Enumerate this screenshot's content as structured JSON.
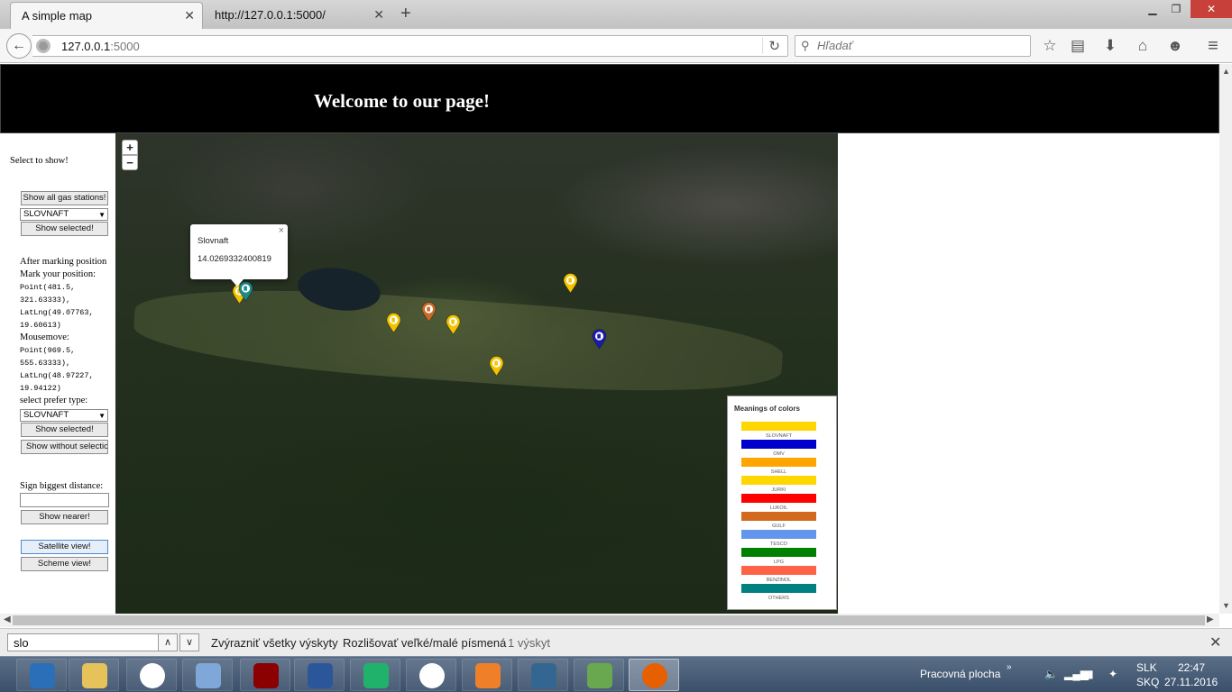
{
  "browser": {
    "tabs": [
      {
        "title": "A simple map",
        "active": true
      },
      {
        "title": "http://127.0.0.1:5000/",
        "active": false
      }
    ],
    "url": "127.0.0.1:5000",
    "url_host": "127.0.0.1",
    "url_port": ":5000",
    "search_placeholder": "Hľadať",
    "icons": [
      "back-arrow-icon",
      "reload-icon",
      "search-icon",
      "bookmark-star-icon",
      "reading-list-icon",
      "download-icon",
      "home-icon",
      "smiley-icon",
      "menu-icon"
    ]
  },
  "page": {
    "heading": "Welcome to our page!",
    "sidebar": {
      "select_to_show": "Select to show!",
      "show_all_button": "Show all gas stations!",
      "station_select_value": "SLOVNAFT",
      "show_selected_button": "Show selected!",
      "after_marking": "After marking position",
      "mark_position": "Mark your position:",
      "mark_point_1": "Point(481.5,",
      "mark_point_2": "321.63333),",
      "mark_latlng_1": "LatLng(49.07763,",
      "mark_latlng_2": "19.60613)",
      "mousemove": "Mousemove:",
      "move_point_1": "Point(969.5,",
      "move_point_2": "555.63333),",
      "move_latlng_1": "LatLng(48.97227,",
      "move_latlng_2": "19.94122)",
      "prefer_type": "select prefer type:",
      "prefer_select_value": "SLOVNAFT",
      "show_selected_button_2": "Show selected!",
      "show_without_button": "Show without selection",
      "sign_distance": "Sign biggest distance:",
      "distance_value": "",
      "show_nearer_button": "Show nearer!",
      "satellite_button": "Satellite view!",
      "scheme_button": "Scheme view!"
    },
    "map": {
      "zoom_in": "+",
      "zoom_out": "−",
      "popup": {
        "title": "Slovnaft",
        "value": "14.0269332400819",
        "close": "×"
      },
      "markers": [
        {
          "brand": "SLOVNAFT",
          "color": "#f5c400"
        },
        {
          "brand": "OTHERS",
          "color": "#1a8a8a"
        },
        {
          "brand": "SLOVNAFT",
          "color": "#f5c400"
        },
        {
          "brand": "GULF",
          "color": "#c86a28"
        },
        {
          "brand": "SLOVNAFT",
          "color": "#f5c400"
        },
        {
          "brand": "SLOVNAFT",
          "color": "#f5c400"
        },
        {
          "brand": "SLOVNAFT",
          "color": "#f5c400"
        },
        {
          "brand": "OMV",
          "color": "#1a1ab0"
        }
      ],
      "legend": {
        "title": "Meanings of colors",
        "items": [
          {
            "label": "SLOVNAFT",
            "color": "#ffd700"
          },
          {
            "label": "OMV",
            "color": "#0000cd"
          },
          {
            "label": "SHELL",
            "color": "#ffa500"
          },
          {
            "label": "JURKI",
            "color": "#ffd700"
          },
          {
            "label": "LUKOIL",
            "color": "#ff0000"
          },
          {
            "label": "GULF",
            "color": "#d2691e"
          },
          {
            "label": "TESCO",
            "color": "#6495ed"
          },
          {
            "label": "LPG",
            "color": "#008000"
          },
          {
            "label": "BENZINOL",
            "color": "#ff6347"
          },
          {
            "label": "OTHERS",
            "color": "#008080"
          }
        ]
      }
    }
  },
  "findbar": {
    "query": "slo",
    "highlight_all": "Zvýrazniť všetky výskyty",
    "match_case": "Rozlišovať veľké/malé písmená",
    "result": "1 výskyt"
  },
  "taskbar": {
    "desktop_label": "Pracovná plocha",
    "lang_1": "SLK",
    "lang_2": "SKQ",
    "time": "22:47",
    "date": "27.11.2016",
    "apps": [
      "windows-start-icon",
      "file-explorer-icon",
      "chrome-icon",
      "paint-icon",
      "power-app-icon",
      "word-icon",
      "pycharm-icon",
      "chrome-icon",
      "media-player-icon",
      "postgres-icon",
      "notepad-icon",
      "firefox-icon"
    ]
  }
}
